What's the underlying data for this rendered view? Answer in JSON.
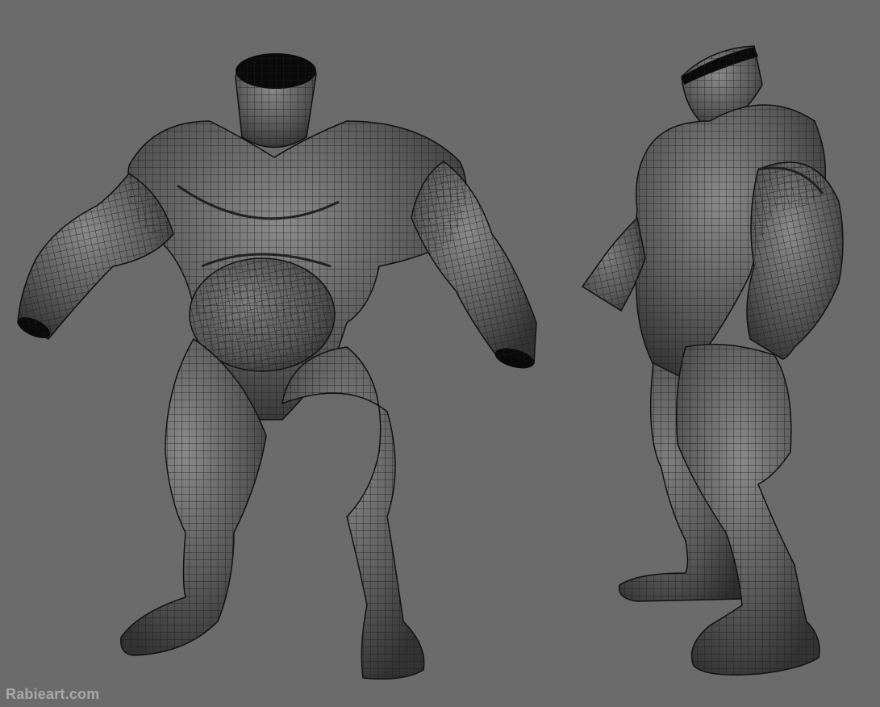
{
  "watermark": "Rabieart.com",
  "background_color": "#6b6b6b",
  "views": [
    {
      "name": "front-three-quarter",
      "subject": "muscular-torso-wireframe"
    },
    {
      "name": "side-three-quarter",
      "subject": "muscular-torso-wireframe"
    }
  ]
}
